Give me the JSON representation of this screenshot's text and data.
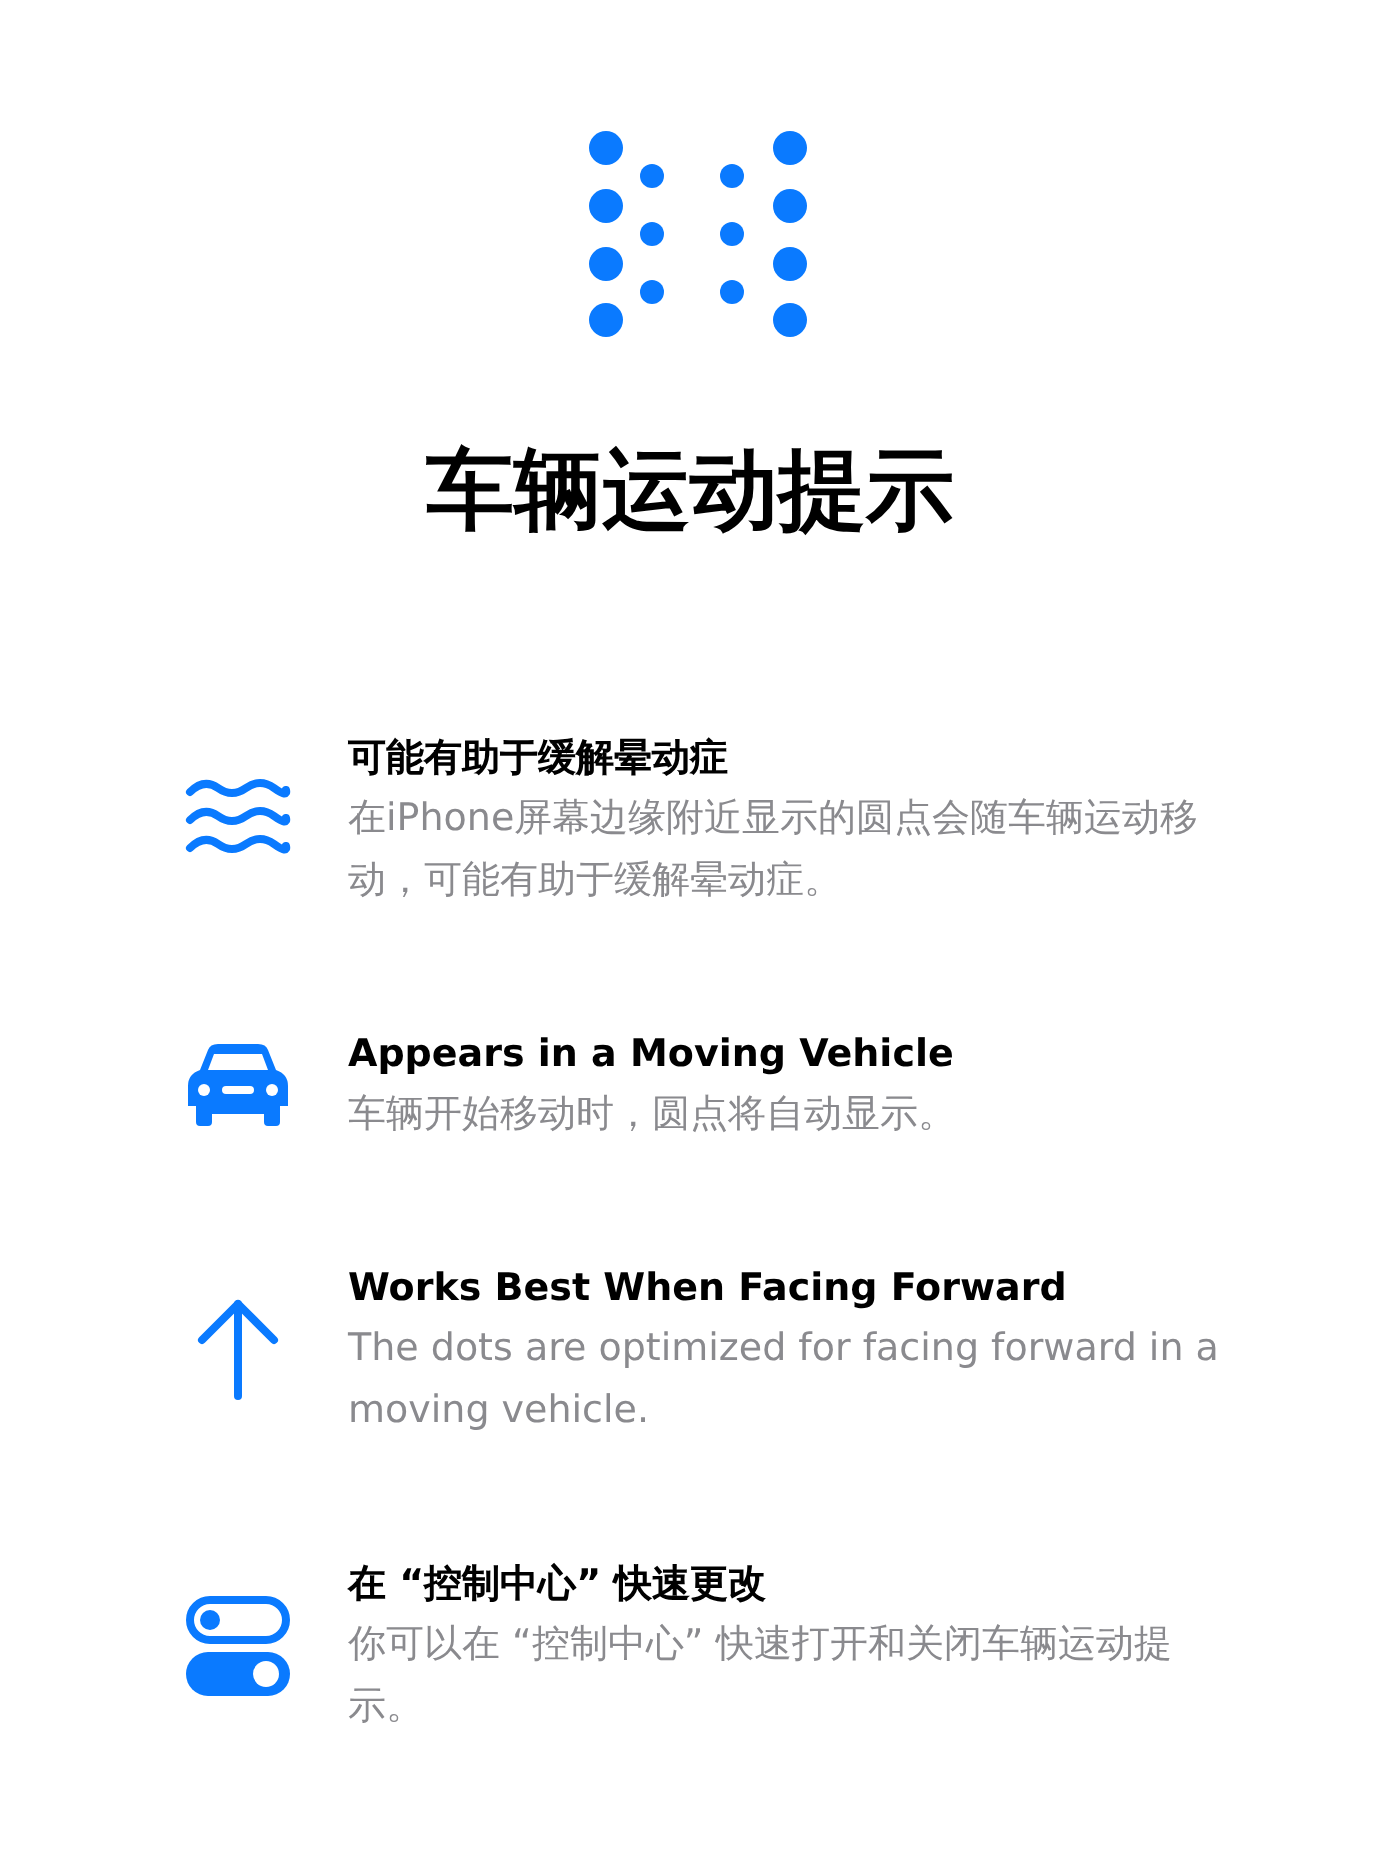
{
  "title": "车辆运动提示",
  "features": [
    {
      "kind": "waves",
      "heading": "可能有助于缓解晕动症",
      "description": "在iPhone屏幕边缘附近显示的圆点会随车辆运动移动，可能有助于缓解晕动症。"
    },
    {
      "kind": "car",
      "heading": "Appears in a Moving Vehicle",
      "description": "车辆开始移动时，圆点将自动显示。"
    },
    {
      "kind": "arrow",
      "heading": "Works Best When Facing Forward",
      "description": "The dots are optimized for facing forward in a moving vehicle."
    },
    {
      "kind": "toggles",
      "heading": "在 “控制中心” 快速更改",
      "description": "你可以在 “控制中心” 快速打开和关闭车辆运动提示。"
    }
  ]
}
